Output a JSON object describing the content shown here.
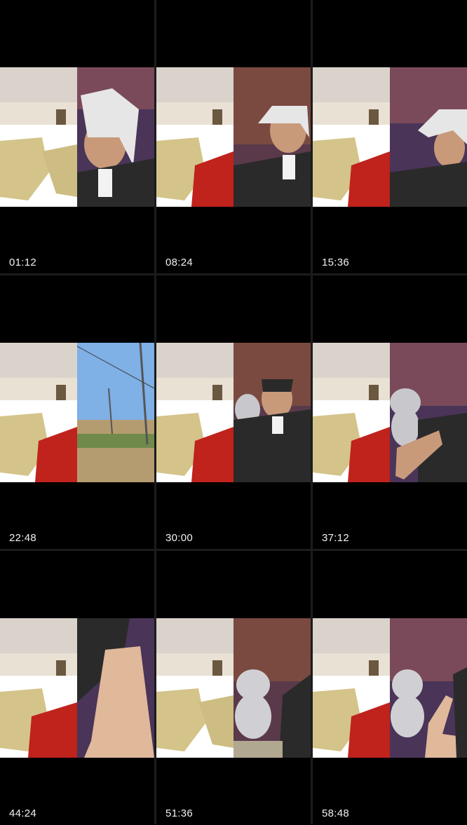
{
  "thumbnails": [
    {
      "timestamp": "01:12",
      "right_scene": "man-headscarf-closeup"
    },
    {
      "timestamp": "08:24",
      "right_scene": "man-headscarf-mid"
    },
    {
      "timestamp": "15:36",
      "right_scene": "man-headscarf-tilted"
    },
    {
      "timestamp": "22:48",
      "right_scene": "outdoor-street"
    },
    {
      "timestamp": "30:00",
      "right_scene": "man-teddy-bear"
    },
    {
      "timestamp": "37:12",
      "right_scene": "teddy-bear-arm"
    },
    {
      "timestamp": "44:24",
      "right_scene": "arm-closeup"
    },
    {
      "timestamp": "51:36",
      "right_scene": "teddy-bear-only"
    },
    {
      "timestamp": "58:48",
      "right_scene": "teddy-bear-hand-wave"
    }
  ],
  "colors": {
    "background": "#000000",
    "headboard": "#e6ddd2",
    "pillow_gold": "#d4c48a",
    "red_blanket": "#c0221c",
    "backdrop_purple": "#5a3a6a",
    "sky_blue": "#7fb0e6"
  }
}
